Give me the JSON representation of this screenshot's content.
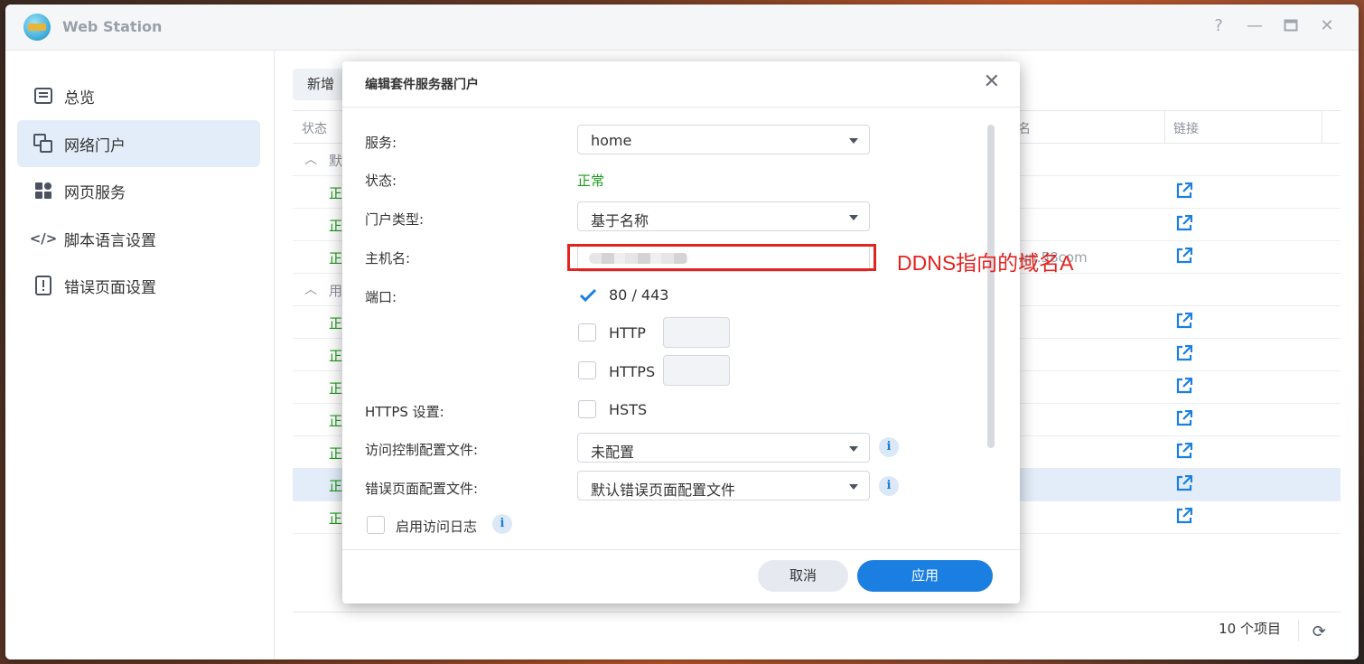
{
  "window": {
    "title": "Web Station"
  },
  "sidebar": {
    "items": [
      {
        "label": "总览",
        "icon": "overview-icon"
      },
      {
        "label": "网络门户",
        "icon": "portal-icon",
        "active": true
      },
      {
        "label": "网页服务",
        "icon": "grid-icon"
      },
      {
        "label": "脚本语言设置",
        "icon": "code-icon"
      },
      {
        "label": "错误页面设置",
        "icon": "error-page-icon"
      }
    ]
  },
  "main": {
    "new_button": "新增",
    "columns": {
      "status": "状态",
      "name_suffix": "名",
      "link": "链接"
    },
    "groups": [
      {
        "label": "默"
      },
      {
        "label": "用"
      }
    ],
    "row_status": "正",
    "footer_count": "10 个项目",
    "peek_text": "wn.58com"
  },
  "dialog": {
    "title": "编辑套件服务器门户",
    "labels": {
      "service": "服务:",
      "status": "状态:",
      "portal_type": "门户类型:",
      "hostname": "主机名:",
      "port": "端口:",
      "https_settings": "HTTPS 设置:",
      "access_control": "访问控制配置文件:",
      "error_page": "错误页面配置文件:"
    },
    "service_value": "home",
    "status_value": "正常",
    "portal_type_value": "基于名称",
    "access_control_value": "未配置",
    "error_page_value": "默认错误页面配置文件",
    "port_80_443": "80 / 443",
    "http_label": "HTTP",
    "https_label": "HTTPS",
    "hsts_label": "HSTS",
    "enable_log_label": "启用访问日志",
    "cancel": "取消",
    "apply": "应用",
    "port_80_443_checked": true
  },
  "annotation": {
    "text": "DDNS指向的域名A",
    "color": "#e32320"
  },
  "colors": {
    "accent": "#1a7fe0",
    "ok": "#1a9b1a",
    "active_bg": "#e3edf9"
  }
}
